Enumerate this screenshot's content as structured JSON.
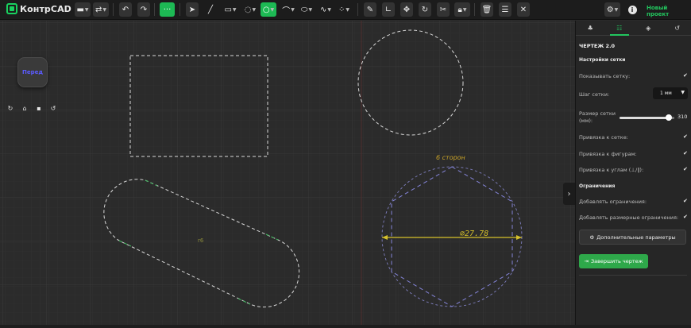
{
  "app": {
    "logo_text": "КонтрCAD"
  },
  "toolbar": {
    "new_project": "Новый проект",
    "icons": [
      "folder-icon",
      "swap-icon",
      "undo-icon",
      "redo-icon",
      "dots-icon",
      "pointer-icon",
      "line-icon",
      "rectangle-icon",
      "circle-icon",
      "circle-filled-icon",
      "arc-icon",
      "ellipse-icon",
      "spline-icon",
      "points-icon",
      "measure-icon",
      "angle-icon",
      "move-icon",
      "rotate-icon",
      "scissors-icon",
      "lock-icon",
      "trash-icon",
      "layers-icon",
      "close-icon",
      "settings-icon",
      "info-icon"
    ],
    "accent_color": "#1db954"
  },
  "canvas": {
    "view_button": "Перед",
    "hexagon_label": "6 сторон",
    "diameter_label": "⌀27.78",
    "slot_label": "r6"
  },
  "panel": {
    "tabs": [
      "shapes-tab",
      "sliders-tab",
      "layers-tab",
      "history-tab"
    ],
    "title": "ЧЕРТЕЖ 2.0",
    "grid_section": "Настройки сетки",
    "show_grid": "Показывать сетку:",
    "grid_step": "Шаг сетки:",
    "grid_step_value": "1 мм",
    "grid_size": "Размер сетки (мм):",
    "grid_size_value": "310",
    "grid_size_fraction": 0.9,
    "snap_grid": "Привязка к сетке:",
    "snap_shapes": "Привязка к фигурам:",
    "snap_angles": "Привязка к углам (⊥/∥):",
    "constraints_section": "Ограничения",
    "add_constraints": "Добавлять ограничения:",
    "add_dim_constraints": "Добавлять размерные ограничения:",
    "advanced_button": "Дополнительные параметры",
    "finish_button": "Завершить чертеж",
    "check_mark": "✔"
  }
}
